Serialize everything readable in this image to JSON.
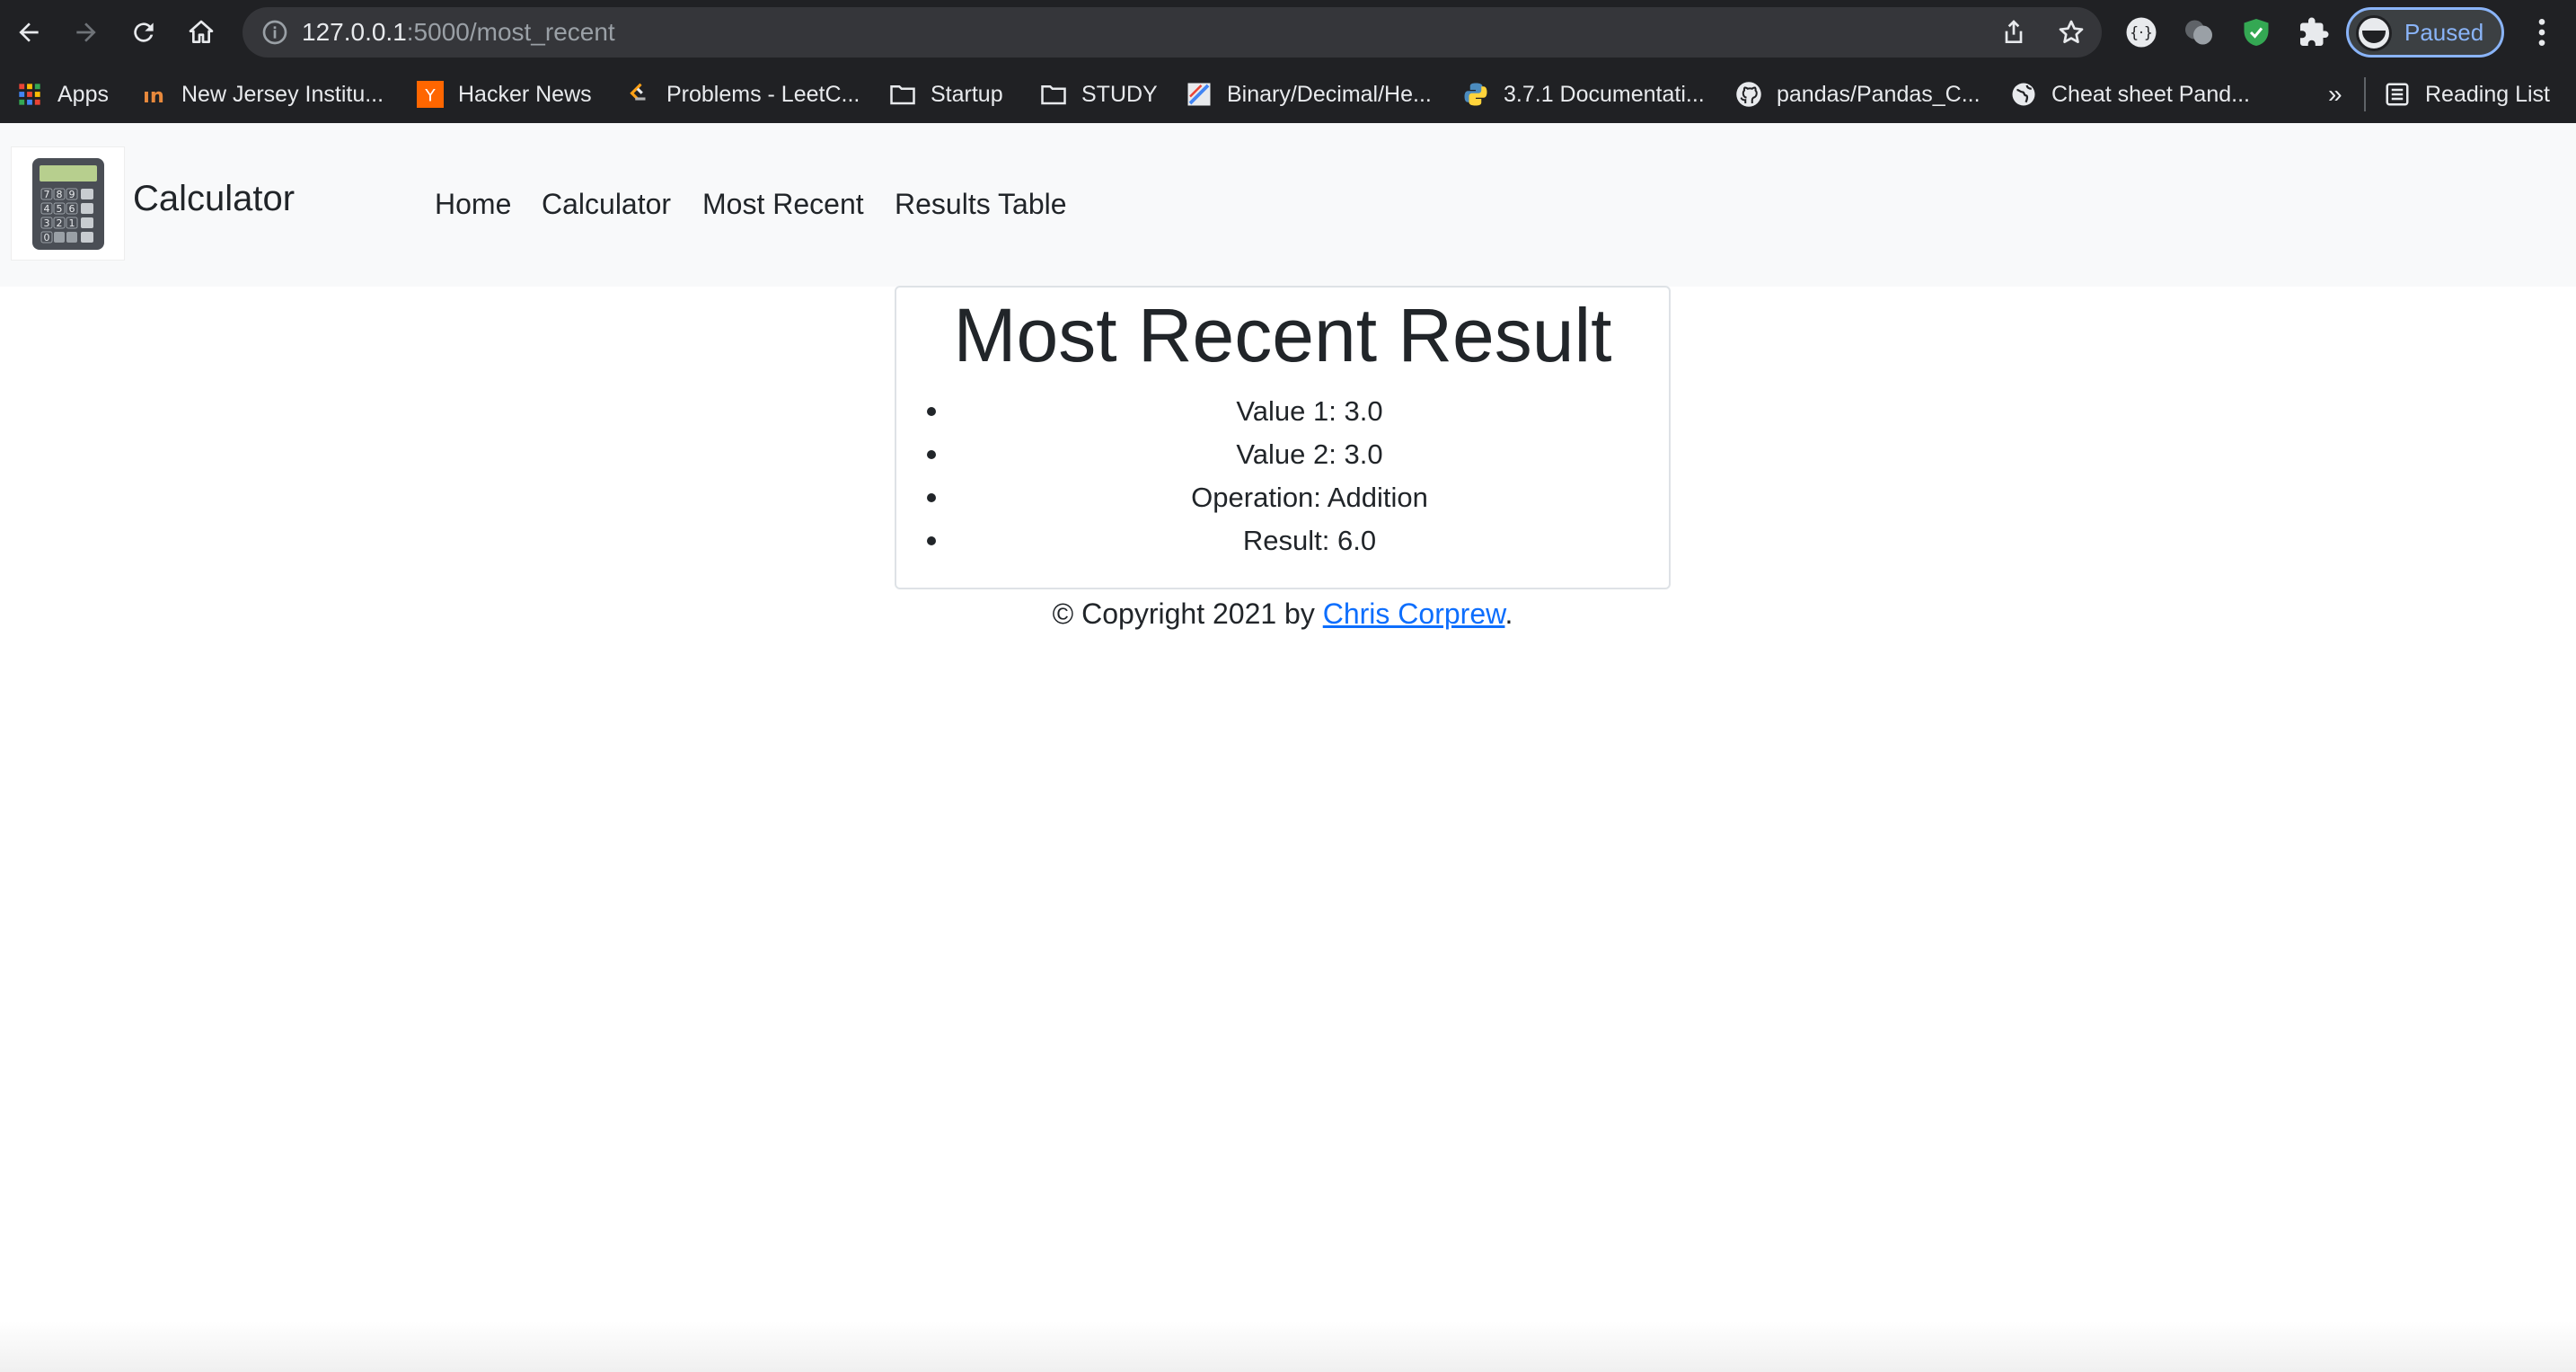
{
  "browser": {
    "url_host": "127.0.0.1",
    "url_path": ":5000/most_recent",
    "profile_label": "Paused",
    "bookmarks": [
      {
        "label": "Apps",
        "icon": "apps-grid-icon"
      },
      {
        "label": "New Jersey Institu...",
        "icon": "njit-icon"
      },
      {
        "label": "Hacker News",
        "icon": "hacker-news-icon"
      },
      {
        "label": "Problems - LeetC...",
        "icon": "leetcode-icon"
      },
      {
        "label": "Startup",
        "icon": "folder-icon"
      },
      {
        "label": "STUDY",
        "icon": "folder-icon"
      },
      {
        "label": "Binary/Decimal/He...",
        "icon": "converter-icon"
      },
      {
        "label": "3.7.1 Documentati...",
        "icon": "python-icon"
      },
      {
        "label": "pandas/Pandas_C...",
        "icon": "github-icon"
      },
      {
        "label": "Cheat sheet Pand...",
        "icon": "globe-icon"
      }
    ],
    "overflow": "»",
    "reading_list": "Reading List"
  },
  "navbar": {
    "brand": "Calculator",
    "links": [
      "Home",
      "Calculator",
      "Most Recent",
      "Results Table"
    ]
  },
  "main": {
    "title": "Most Recent Result",
    "items": [
      "Value 1: 3.0",
      "Value 2: 3.0",
      "Operation: Addition",
      "Result: 6.0"
    ]
  },
  "footer": {
    "prefix": "© Copyright 2021 by ",
    "link": "Chris Corprew",
    "suffix": "."
  },
  "colors": {
    "link": "#0d6efd",
    "chrome_bg": "#202124",
    "navbar_bg": "#f8f9fa"
  }
}
